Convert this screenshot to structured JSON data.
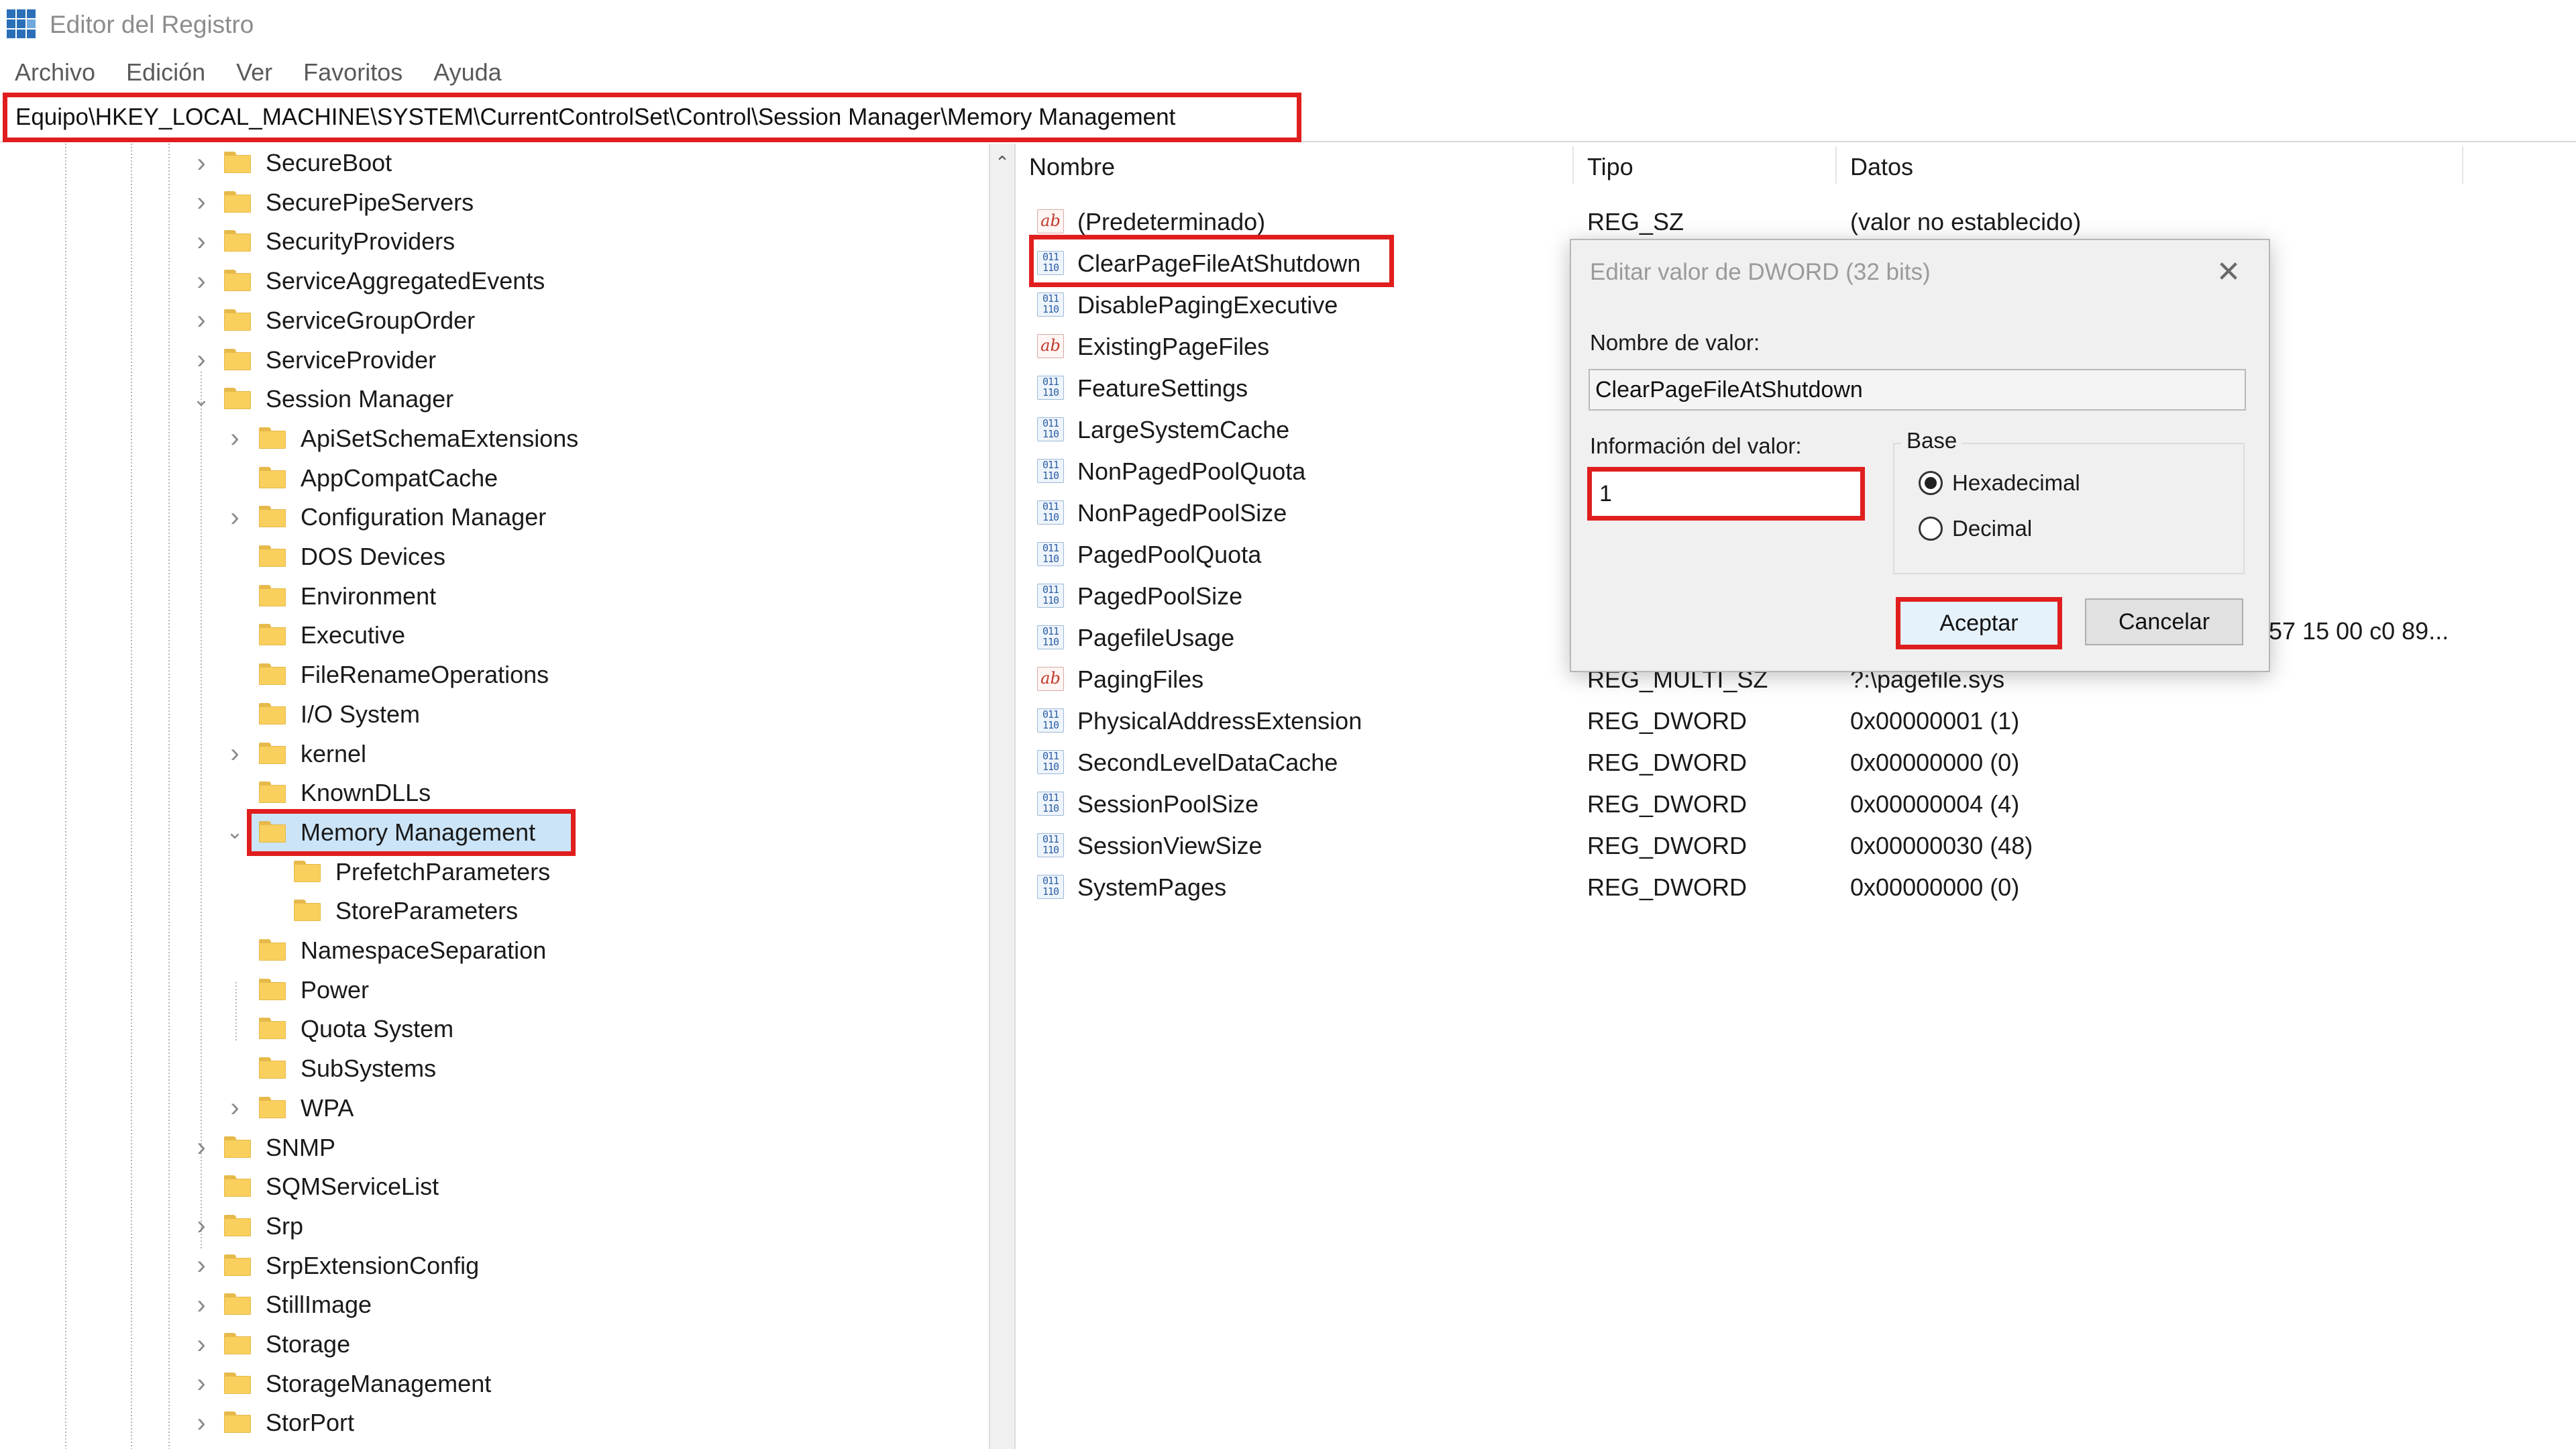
{
  "window": {
    "title": "Editor del Registro"
  },
  "menu": [
    "Archivo",
    "Edición",
    "Ver",
    "Favoritos",
    "Ayuda"
  ],
  "address": "Equipo\\HKEY_LOCAL_MACHINE\\SYSTEM\\CurrentControlSet\\Control\\Session Manager\\Memory Management",
  "tree": [
    {
      "label": "SecureBoot",
      "level": 1,
      "expander": "collapsed"
    },
    {
      "label": "SecurePipeServers",
      "level": 1,
      "expander": "collapsed"
    },
    {
      "label": "SecurityProviders",
      "level": 1,
      "expander": "collapsed"
    },
    {
      "label": "ServiceAggregatedEvents",
      "level": 1,
      "expander": "collapsed"
    },
    {
      "label": "ServiceGroupOrder",
      "level": 1,
      "expander": "collapsed"
    },
    {
      "label": "ServiceProvider",
      "level": 1,
      "expander": "collapsed"
    },
    {
      "label": "Session Manager",
      "level": 1,
      "expander": "expanded"
    },
    {
      "label": "ApiSetSchemaExtensions",
      "level": 2,
      "expander": "collapsed"
    },
    {
      "label": "AppCompatCache",
      "level": 2,
      "expander": "none"
    },
    {
      "label": "Configuration Manager",
      "level": 2,
      "expander": "collapsed"
    },
    {
      "label": "DOS Devices",
      "level": 2,
      "expander": "none"
    },
    {
      "label": "Environment",
      "level": 2,
      "expander": "none"
    },
    {
      "label": "Executive",
      "level": 2,
      "expander": "none"
    },
    {
      "label": "FileRenameOperations",
      "level": 2,
      "expander": "none"
    },
    {
      "label": "I/O System",
      "level": 2,
      "expander": "none"
    },
    {
      "label": "kernel",
      "level": 2,
      "expander": "collapsed"
    },
    {
      "label": "KnownDLLs",
      "level": 2,
      "expander": "none"
    },
    {
      "label": "Memory Management",
      "level": 2,
      "expander": "expanded",
      "selected": true
    },
    {
      "label": "PrefetchParameters",
      "level": 3,
      "expander": "none"
    },
    {
      "label": "StoreParameters",
      "level": 3,
      "expander": "none"
    },
    {
      "label": "NamespaceSeparation",
      "level": 2,
      "expander": "none"
    },
    {
      "label": "Power",
      "level": 2,
      "expander": "none"
    },
    {
      "label": "Quota System",
      "level": 2,
      "expander": "none"
    },
    {
      "label": "SubSystems",
      "level": 2,
      "expander": "none"
    },
    {
      "label": "WPA",
      "level": 2,
      "expander": "collapsed"
    },
    {
      "label": "SNMP",
      "level": 1,
      "expander": "collapsed"
    },
    {
      "label": "SQMServiceList",
      "level": 1,
      "expander": "none"
    },
    {
      "label": "Srp",
      "level": 1,
      "expander": "collapsed"
    },
    {
      "label": "SrpExtensionConfig",
      "level": 1,
      "expander": "collapsed"
    },
    {
      "label": "StillImage",
      "level": 1,
      "expander": "collapsed"
    },
    {
      "label": "Storage",
      "level": 1,
      "expander": "collapsed"
    },
    {
      "label": "StorageManagement",
      "level": 1,
      "expander": "collapsed"
    },
    {
      "label": "StorPort",
      "level": 1,
      "expander": "collapsed"
    }
  ],
  "list": {
    "columns": [
      "Nombre",
      "Tipo",
      "Datos"
    ],
    "rows": [
      {
        "icon": "string-value-icon",
        "name": "(Predeterminado)",
        "type": "REG_SZ",
        "data": "(valor no establecido)"
      },
      {
        "icon": "binary-value-icon",
        "name": "ClearPageFileAtShutdown",
        "type": "",
        "data": ""
      },
      {
        "icon": "binary-value-icon",
        "name": "DisablePagingExecutive",
        "type": "",
        "data": ""
      },
      {
        "icon": "string-value-icon",
        "name": "ExistingPageFiles",
        "type": "",
        "data": ""
      },
      {
        "icon": "binary-value-icon",
        "name": "FeatureSettings",
        "type": "",
        "data": ""
      },
      {
        "icon": "binary-value-icon",
        "name": "LargeSystemCache",
        "type": "",
        "data": ""
      },
      {
        "icon": "binary-value-icon",
        "name": "NonPagedPoolQuota",
        "type": "",
        "data": ""
      },
      {
        "icon": "binary-value-icon",
        "name": "NonPagedPoolSize",
        "type": "",
        "data": ""
      },
      {
        "icon": "binary-value-icon",
        "name": "PagedPoolQuota",
        "type": "",
        "data": ""
      },
      {
        "icon": "binary-value-icon",
        "name": "PagedPoolSize",
        "type": "",
        "data": ""
      },
      {
        "icon": "binary-value-icon",
        "name": "PagefileUsage",
        "type": "",
        "data": ""
      },
      {
        "icon": "string-value-icon",
        "name": "PagingFiles",
        "type": "REG_MULTI_SZ",
        "data": "?:\\pagefile.sys"
      },
      {
        "icon": "binary-value-icon",
        "name": "PhysicalAddressExtension",
        "type": "REG_DWORD",
        "data": "0x00000001 (1)"
      },
      {
        "icon": "binary-value-icon",
        "name": "SecondLevelDataCache",
        "type": "REG_DWORD",
        "data": "0x00000000 (0)"
      },
      {
        "icon": "binary-value-icon",
        "name": "SessionPoolSize",
        "type": "REG_DWORD",
        "data": "0x00000004 (4)"
      },
      {
        "icon": "binary-value-icon",
        "name": "SessionViewSize",
        "type": "REG_DWORD",
        "data": "0x00000030 (48)"
      },
      {
        "icon": "binary-value-icon",
        "name": "SystemPages",
        "type": "REG_DWORD",
        "data": "0x00000000 (0)"
      }
    ],
    "pagefile_usage_data_tail": "57 15 00 c0 89..."
  },
  "dialog": {
    "title": "Editar valor de DWORD (32 bits)",
    "close_glyph": "✕",
    "name_label": "Nombre de valor:",
    "name_value": "ClearPageFileAtShutdown",
    "data_label": "Información del valor:",
    "data_value": "1",
    "base_label": "Base",
    "radio_hex": "Hexadecimal",
    "radio_dec": "Decimal",
    "selected_base": "Hexadecimal",
    "ok_label": "Aceptar",
    "cancel_label": "Cancelar"
  },
  "colors": {
    "highlight_red": "#e01e1e",
    "selection_blue": "#cce4f7",
    "folder_yellow": "#f9cf5e"
  }
}
